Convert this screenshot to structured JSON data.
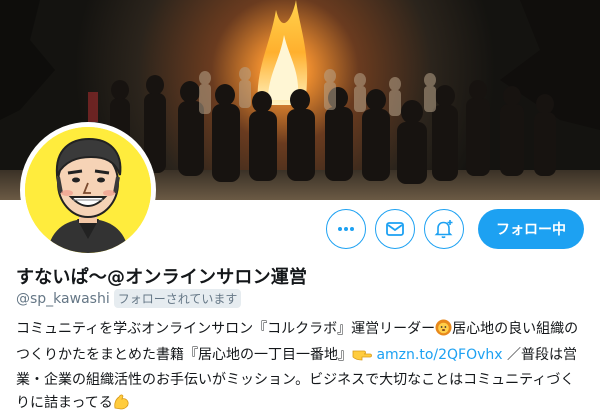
{
  "profile": {
    "display_name": "すないぱ〜@オンラインサロン運営",
    "handle": "@sp_kawashi",
    "follows_you_badge": "フォローされています"
  },
  "actions": {
    "more_icon": "more-dots-icon",
    "message_icon": "envelope-icon",
    "notify_icon": "bell-plus-icon",
    "follow_label": "フォロー中"
  },
  "bio": {
    "part1": "コミュニティを学ぶオンラインサロン『コルクラボ』運営リーダー",
    "emoji1": "lion-face-emoji",
    "part2": "居心地の良い組織のつくりかたをまとめた書籍『居心地の一丁目一番地』",
    "emoji2": "pointing-right-emoji",
    "link": "amzn.to/2QFOvhx",
    "part3": " ／普段は営業・企業の組織活性のお手伝いがミッション。ビジネスで大切なことはコミュニティづくりに詰まってる",
    "emoji3": "flexed-biceps-emoji"
  },
  "colors": {
    "accent": "#1da1f2",
    "text": "#14171a",
    "muted": "#657786",
    "avatar_bg": "#ffec3d"
  }
}
